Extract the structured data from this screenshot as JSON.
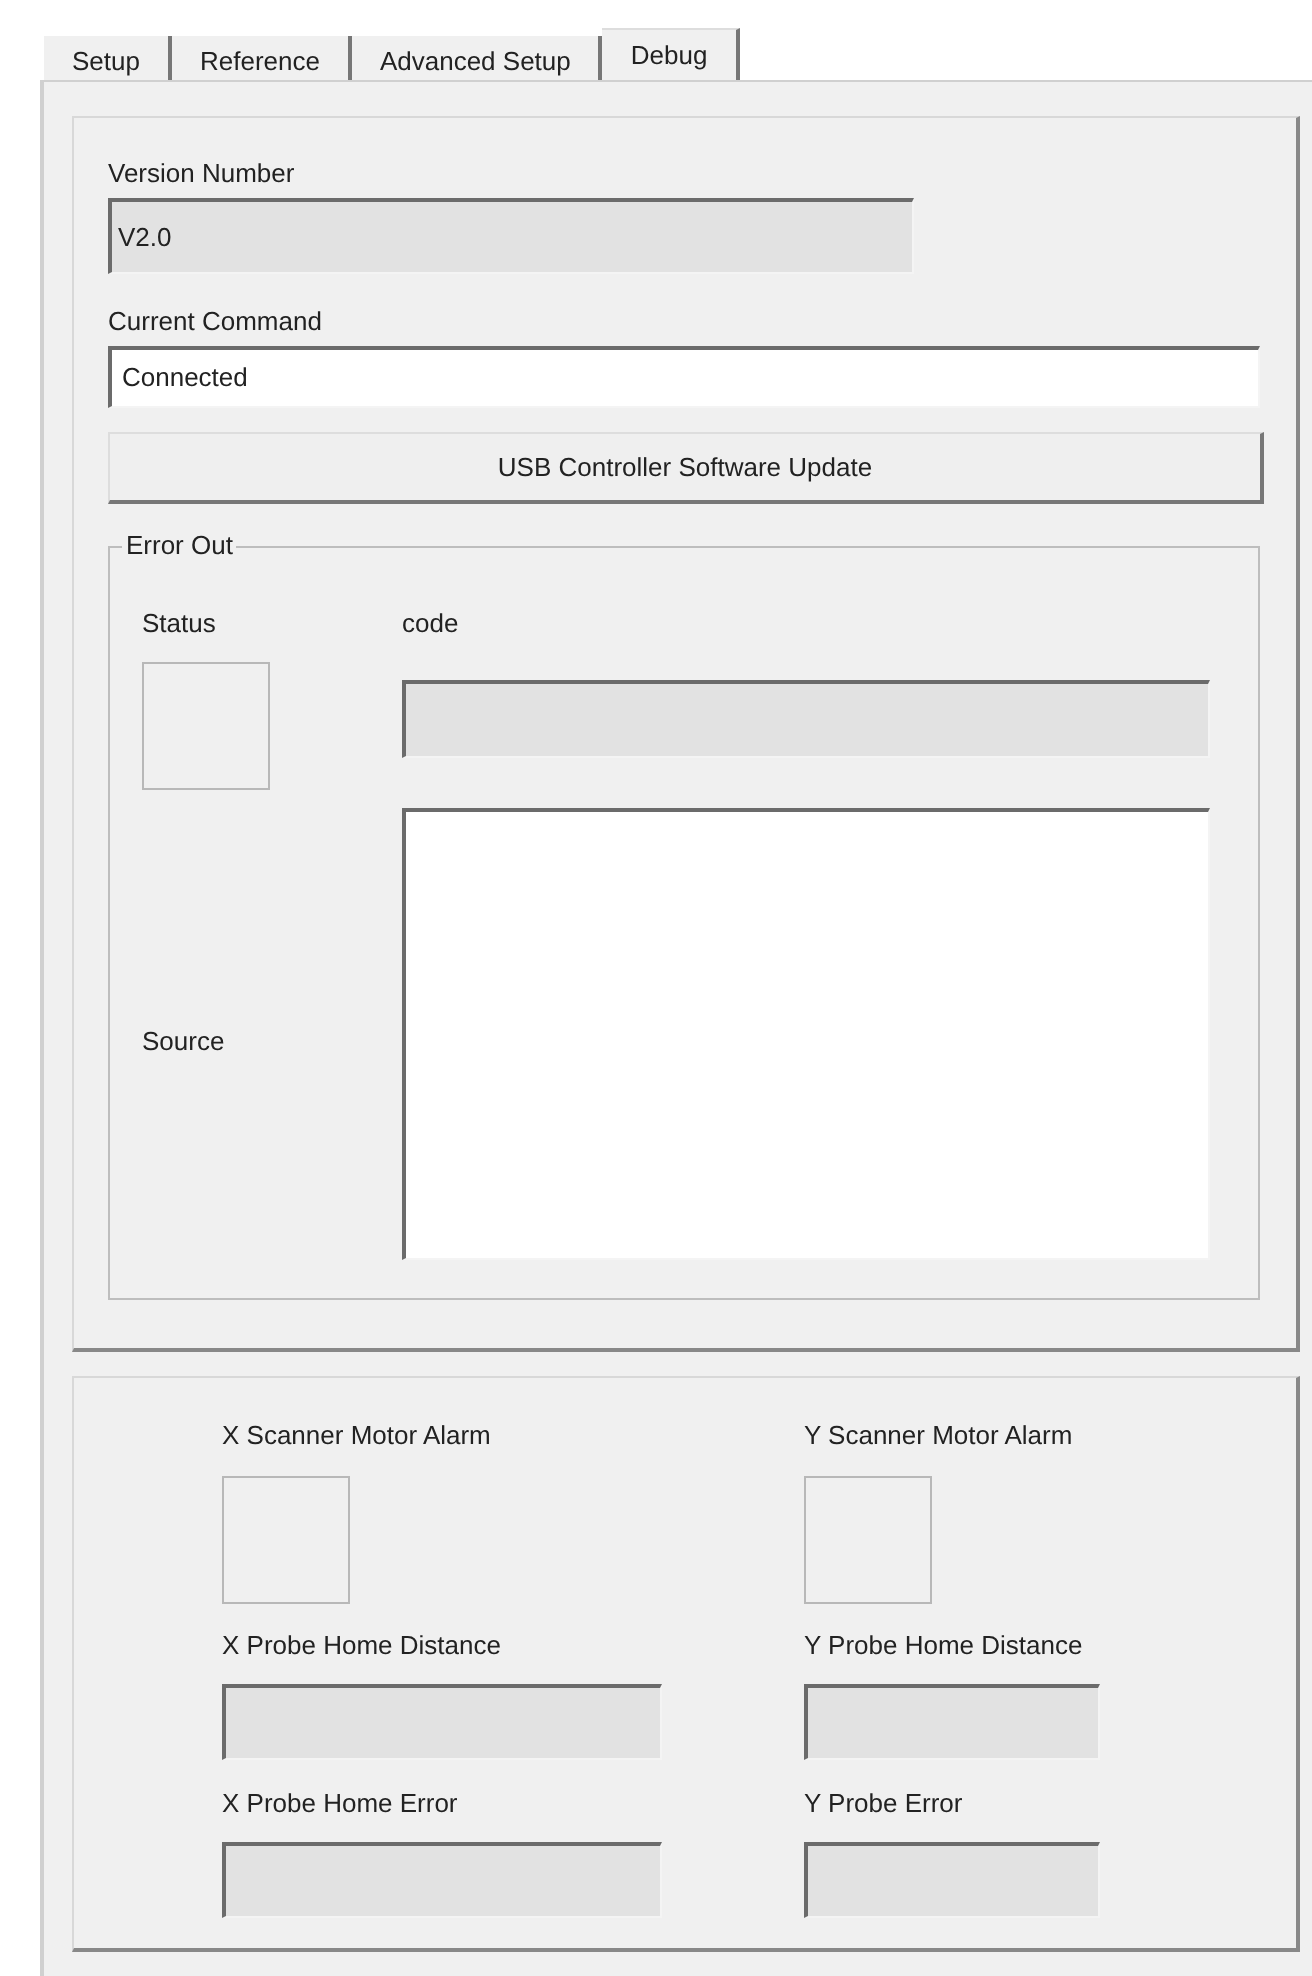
{
  "tabs": [
    {
      "label": "Setup",
      "selected": false
    },
    {
      "label": "Reference",
      "selected": false
    },
    {
      "label": "Advanced Setup",
      "selected": false
    },
    {
      "label": "Debug",
      "selected": true
    }
  ],
  "version": {
    "label": "Version Number",
    "value": "V2.0"
  },
  "current_command": {
    "label": "Current Command",
    "value": "Connected"
  },
  "update_button": "USB Controller Software Update",
  "error_out": {
    "title": "Error Out",
    "status_label": "Status",
    "code_label": "code",
    "source_label": "Source"
  },
  "scanner": {
    "x_alarm_label": "X Scanner Motor Alarm",
    "y_alarm_label": "Y Scanner Motor Alarm",
    "x_distance_label": "X Probe Home Distance",
    "y_distance_label": "Y Probe Home Distance",
    "x_error_label": "X Probe Home Error",
    "y_error_label": "Y Probe Error"
  }
}
